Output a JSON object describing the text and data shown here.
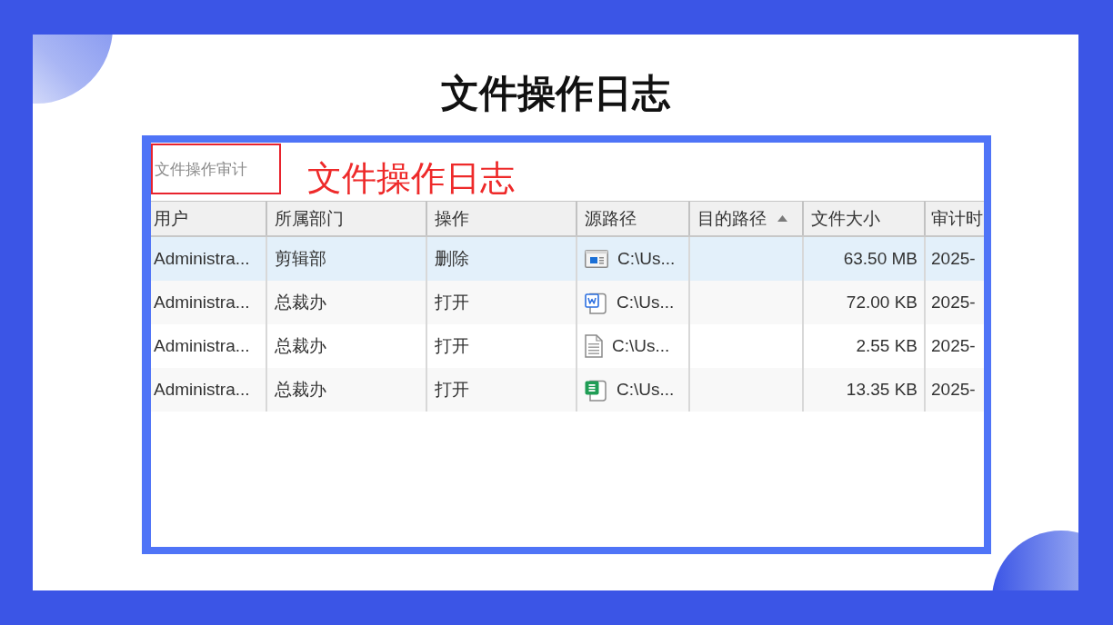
{
  "title": "文件操作日志",
  "screenshot": {
    "tab": "文件操作审计",
    "annotation": "文件操作日志",
    "table": {
      "columns": [
        {
          "label": "用户",
          "sorted": false
        },
        {
          "label": "所属部门",
          "sorted": false
        },
        {
          "label": "操作",
          "sorted": false
        },
        {
          "label": "源路径",
          "sorted": false
        },
        {
          "label": "目的路径",
          "sorted": true
        },
        {
          "label": "文件大小",
          "sorted": false
        },
        {
          "label": "审计时",
          "sorted": false
        }
      ],
      "rows": [
        {
          "selected": true,
          "kind": "media",
          "user": "Administra...",
          "department": "剪辑部",
          "operation": "删除",
          "source_path": "C:\\Us...",
          "file_size": "63.50 MB",
          "column_7": "2025-"
        },
        {
          "selected": false,
          "kind": "word",
          "user": "Administra...",
          "department": "总裁办",
          "operation": "打开",
          "source_path": "C:\\Us...",
          "file_size": "72.00 KB",
          "column_7": "2025-"
        },
        {
          "selected": false,
          "kind": "text",
          "user": "Administra...",
          "department": "总裁办",
          "operation": "打开",
          "source_path": "C:\\Us...",
          "file_size": "2.55 KB",
          "column_7": "2025-"
        },
        {
          "selected": false,
          "kind": "sheet",
          "user": "Administra...",
          "department": "总裁办",
          "operation": "打开",
          "source_path": "C:\\Us...",
          "file_size": "13.35 KB",
          "column_7": "2025-"
        }
      ]
    }
  }
}
